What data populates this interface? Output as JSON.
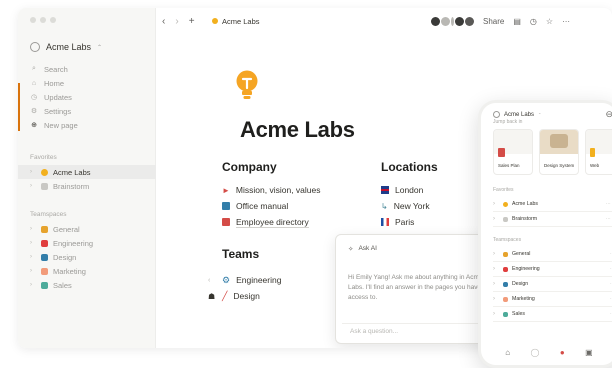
{
  "window": {
    "sidebar": {
      "workspace": "Acme Labs",
      "nav": [
        {
          "icon": "search-icon",
          "label": "Search"
        },
        {
          "icon": "home-icon",
          "label": "Home"
        },
        {
          "icon": "updates-icon",
          "label": "Updates"
        },
        {
          "icon": "settings-icon",
          "label": "Settings"
        },
        {
          "icon": "plus-icon",
          "label": "New page"
        }
      ],
      "favorites_label": "Favorites",
      "favorites": [
        {
          "label": "Acme Labs",
          "color": "#f2b01e"
        },
        {
          "label": "Brainstorm",
          "color": "#c9c8c4"
        }
      ],
      "teamspaces_label": "Teamspaces",
      "teamspaces": [
        {
          "label": "General",
          "color": "#e6a32d"
        },
        {
          "label": "Engineering",
          "color": "#e03e3e"
        },
        {
          "label": "Design",
          "color": "#337ea9"
        },
        {
          "label": "Marketing",
          "color": "#f29b7a"
        },
        {
          "label": "Sales",
          "color": "#4dab9a"
        }
      ]
    },
    "topbar": {
      "breadcrumb": "Acme Labs",
      "share": "Share"
    }
  },
  "page": {
    "title": "Acme Labs",
    "company": {
      "heading": "Company",
      "links": [
        {
          "label": "Mission, vision, values",
          "color": "#d44c47"
        },
        {
          "label": "Office manual",
          "color": "#337ea9"
        },
        {
          "label": "Employee directory",
          "color": "#d44c47"
        }
      ]
    },
    "locations": {
      "heading": "Locations",
      "links": [
        {
          "label": "London"
        },
        {
          "label": "New York"
        },
        {
          "label": "Paris"
        }
      ]
    },
    "teams": {
      "heading": "Teams",
      "links": [
        {
          "label": "Engineering"
        },
        {
          "label": "Design"
        }
      ]
    }
  },
  "ask_ai": {
    "title": "Ask AI",
    "message": "Hi Emily Yang! Ask me about anything in Acme Labs. I'll find an answer in the pages you have access to.",
    "placeholder": "Ask a question..."
  },
  "phone": {
    "workspace": "Acme Labs",
    "jump_back": "Jump back in",
    "cards": [
      {
        "label": "Sales Plan"
      },
      {
        "label": "Design System"
      },
      {
        "label": "Web"
      }
    ],
    "favorites_label": "Favorites",
    "favorites": [
      {
        "label": "Acme Labs"
      },
      {
        "label": "Brainstorm"
      }
    ],
    "teamspaces_label": "Teamspaces",
    "teamspaces": [
      {
        "label": "General"
      },
      {
        "label": "Engineering"
      },
      {
        "label": "Design"
      },
      {
        "label": "Marketing"
      },
      {
        "label": "Sales"
      }
    ]
  }
}
